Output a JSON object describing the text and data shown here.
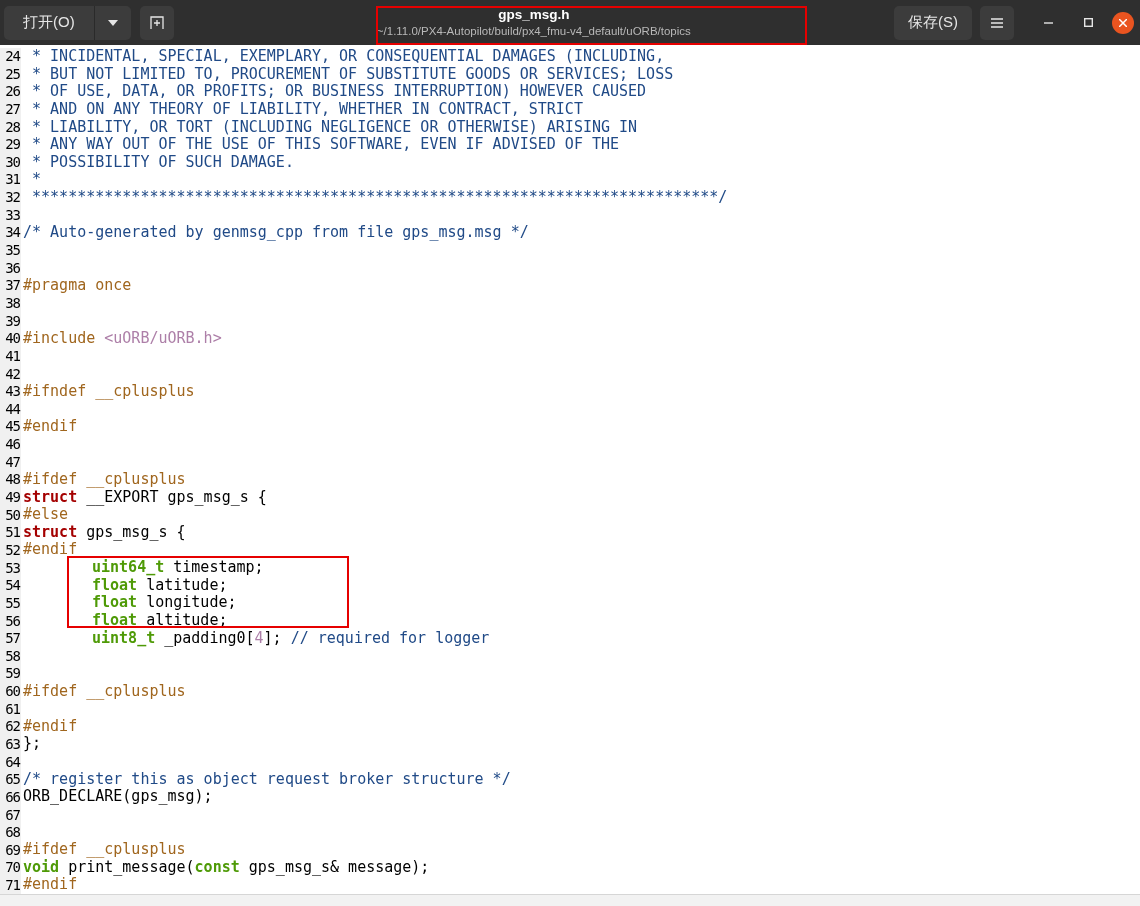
{
  "header": {
    "open_button": "打开(O)",
    "title": "gps_msg.h",
    "path": "~/1.11.0/PX4-Autopilot/build/px4_fmu-v4_default/uORB/topics",
    "save_button": "保存(S)"
  },
  "editor": {
    "lines": [
      {
        "number": "24",
        "tokens": [
          {
            "kind": "comment",
            "text": " * INCIDENTAL, SPECIAL, EXEMPLARY, OR CONSEQUENTIAL DAMAGES (INCLUDING,"
          }
        ]
      },
      {
        "number": "25",
        "tokens": [
          {
            "kind": "comment",
            "text": " * BUT NOT LIMITED TO, PROCUREMENT OF SUBSTITUTE GOODS OR SERVICES; LOSS"
          }
        ]
      },
      {
        "number": "26",
        "tokens": [
          {
            "kind": "comment",
            "text": " * OF USE, DATA, OR PROFITS; OR BUSINESS INTERRUPTION) HOWEVER CAUSED"
          }
        ]
      },
      {
        "number": "27",
        "tokens": [
          {
            "kind": "comment",
            "text": " * AND ON ANY THEORY OF LIABILITY, WHETHER IN CONTRACT, STRICT"
          }
        ]
      },
      {
        "number": "28",
        "tokens": [
          {
            "kind": "comment",
            "text": " * LIABILITY, OR TORT (INCLUDING NEGLIGENCE OR OTHERWISE) ARISING IN"
          }
        ]
      },
      {
        "number": "29",
        "tokens": [
          {
            "kind": "comment",
            "text": " * ANY WAY OUT OF THE USE OF THIS SOFTWARE, EVEN IF ADVISED OF THE"
          }
        ]
      },
      {
        "number": "30",
        "tokens": [
          {
            "kind": "comment",
            "text": " * POSSIBILITY OF SUCH DAMAGE."
          }
        ]
      },
      {
        "number": "31",
        "tokens": [
          {
            "kind": "comment",
            "text": " *"
          }
        ]
      },
      {
        "number": "32",
        "tokens": [
          {
            "kind": "comment",
            "text": " ****************************************************************************/"
          }
        ]
      },
      {
        "number": "33"
      },
      {
        "number": "34",
        "tokens": [
          {
            "kind": "comment",
            "text": "/* Auto-generated by genmsg_cpp from file gps_msg.msg */"
          }
        ]
      },
      {
        "number": "35"
      },
      {
        "number": "36"
      },
      {
        "number": "37",
        "tokens": [
          {
            "kind": "preproc",
            "text": "#pragma once"
          }
        ]
      },
      {
        "number": "38"
      },
      {
        "number": "39"
      },
      {
        "number": "40",
        "tokens": [
          {
            "kind": "preproc",
            "text": "#include "
          },
          {
            "kind": "string",
            "text": "<uORB/uORB.h>"
          }
        ]
      },
      {
        "number": "41"
      },
      {
        "number": "42"
      },
      {
        "number": "43",
        "tokens": [
          {
            "kind": "preproc",
            "text": "#ifndef __cplusplus"
          }
        ]
      },
      {
        "number": "44"
      },
      {
        "number": "45",
        "tokens": [
          {
            "kind": "preproc",
            "text": "#endif"
          }
        ]
      },
      {
        "number": "46"
      },
      {
        "number": "47"
      },
      {
        "number": "48",
        "tokens": [
          {
            "kind": "preproc",
            "text": "#ifdef __cplusplus"
          }
        ]
      },
      {
        "number": "49",
        "tokens": [
          {
            "kind": "keyword",
            "text": "struct"
          },
          {
            "kind": "plain",
            "text": " __EXPORT gps_msg_s {"
          }
        ]
      },
      {
        "number": "50",
        "tokens": [
          {
            "kind": "preproc",
            "text": "#else"
          }
        ]
      },
      {
        "number": "51",
        "tokens": [
          {
            "kind": "keyword",
            "text": "struct"
          },
          {
            "kind": "plain",
            "text": " gps_msg_s {"
          }
        ]
      },
      {
        "number": "52",
        "tokens": [
          {
            "kind": "preproc",
            "text": "#endif"
          }
        ]
      },
      {
        "number": "53",
        "indented": true,
        "tokens": [
          {
            "kind": "type",
            "text": "uint64_t"
          },
          {
            "kind": "plain",
            "text": " timestamp;"
          }
        ]
      },
      {
        "number": "54",
        "indented": true,
        "tokens": [
          {
            "kind": "type",
            "text": "float"
          },
          {
            "kind": "plain",
            "text": " latitude;"
          }
        ]
      },
      {
        "number": "55",
        "indented": true,
        "tokens": [
          {
            "kind": "type",
            "text": "float"
          },
          {
            "kind": "plain",
            "text": " longitude;"
          }
        ]
      },
      {
        "number": "56",
        "indented": true,
        "tokens": [
          {
            "kind": "type",
            "text": "float"
          },
          {
            "kind": "plain",
            "text": " altitude;"
          }
        ]
      },
      {
        "number": "57",
        "indented": true,
        "tokens": [
          {
            "kind": "type",
            "text": "uint8_t"
          },
          {
            "kind": "plain",
            "text": " _padding0["
          },
          {
            "kind": "number",
            "text": "4"
          },
          {
            "kind": "plain",
            "text": "];"
          },
          {
            "kind": "comment",
            "text": " // required for logger"
          }
        ]
      },
      {
        "number": "58"
      },
      {
        "number": "59"
      },
      {
        "number": "60",
        "tokens": [
          {
            "kind": "preproc",
            "text": "#ifdef __cplusplus"
          }
        ]
      },
      {
        "number": "61"
      },
      {
        "number": "62",
        "tokens": [
          {
            "kind": "preproc",
            "text": "#endif"
          }
        ]
      },
      {
        "number": "63",
        "tokens": [
          {
            "kind": "plain",
            "text": "};"
          }
        ]
      },
      {
        "number": "64"
      },
      {
        "number": "65",
        "tokens": [
          {
            "kind": "comment",
            "text": "/* register this as object request broker structure */"
          }
        ]
      },
      {
        "number": "66",
        "tokens": [
          {
            "kind": "plain",
            "text": "ORB_DECLARE(gps_msg);"
          }
        ]
      },
      {
        "number": "67"
      },
      {
        "number": "68"
      },
      {
        "number": "69",
        "tokens": [
          {
            "kind": "preproc",
            "text": "#ifdef __cplusplus"
          }
        ]
      },
      {
        "number": "70",
        "tokens": [
          {
            "kind": "type",
            "text": "void"
          },
          {
            "kind": "plain",
            "text": " print_message("
          },
          {
            "kind": "type",
            "text": "const"
          },
          {
            "kind": "plain",
            "text": " gps_msg_s& message);"
          }
        ]
      },
      {
        "number": "71",
        "tokens": [
          {
            "kind": "preproc",
            "text": "#endif"
          }
        ]
      }
    ]
  }
}
